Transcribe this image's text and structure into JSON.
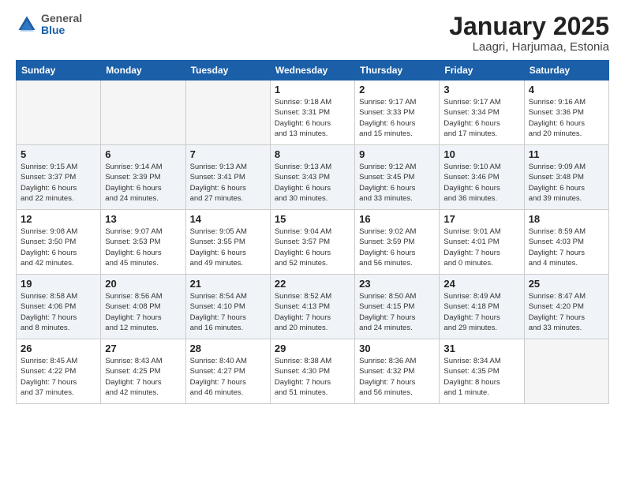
{
  "header": {
    "logo_general": "General",
    "logo_blue": "Blue",
    "title": "January 2025",
    "subtitle": "Laagri, Harjumaa, Estonia"
  },
  "weekdays": [
    "Sunday",
    "Monday",
    "Tuesday",
    "Wednesday",
    "Thursday",
    "Friday",
    "Saturday"
  ],
  "weeks": [
    [
      {
        "day": "",
        "info": ""
      },
      {
        "day": "",
        "info": ""
      },
      {
        "day": "",
        "info": ""
      },
      {
        "day": "1",
        "info": "Sunrise: 9:18 AM\nSunset: 3:31 PM\nDaylight: 6 hours\nand 13 minutes."
      },
      {
        "day": "2",
        "info": "Sunrise: 9:17 AM\nSunset: 3:33 PM\nDaylight: 6 hours\nand 15 minutes."
      },
      {
        "day": "3",
        "info": "Sunrise: 9:17 AM\nSunset: 3:34 PM\nDaylight: 6 hours\nand 17 minutes."
      },
      {
        "day": "4",
        "info": "Sunrise: 9:16 AM\nSunset: 3:36 PM\nDaylight: 6 hours\nand 20 minutes."
      }
    ],
    [
      {
        "day": "5",
        "info": "Sunrise: 9:15 AM\nSunset: 3:37 PM\nDaylight: 6 hours\nand 22 minutes."
      },
      {
        "day": "6",
        "info": "Sunrise: 9:14 AM\nSunset: 3:39 PM\nDaylight: 6 hours\nand 24 minutes."
      },
      {
        "day": "7",
        "info": "Sunrise: 9:13 AM\nSunset: 3:41 PM\nDaylight: 6 hours\nand 27 minutes."
      },
      {
        "day": "8",
        "info": "Sunrise: 9:13 AM\nSunset: 3:43 PM\nDaylight: 6 hours\nand 30 minutes."
      },
      {
        "day": "9",
        "info": "Sunrise: 9:12 AM\nSunset: 3:45 PM\nDaylight: 6 hours\nand 33 minutes."
      },
      {
        "day": "10",
        "info": "Sunrise: 9:10 AM\nSunset: 3:46 PM\nDaylight: 6 hours\nand 36 minutes."
      },
      {
        "day": "11",
        "info": "Sunrise: 9:09 AM\nSunset: 3:48 PM\nDaylight: 6 hours\nand 39 minutes."
      }
    ],
    [
      {
        "day": "12",
        "info": "Sunrise: 9:08 AM\nSunset: 3:50 PM\nDaylight: 6 hours\nand 42 minutes."
      },
      {
        "day": "13",
        "info": "Sunrise: 9:07 AM\nSunset: 3:53 PM\nDaylight: 6 hours\nand 45 minutes."
      },
      {
        "day": "14",
        "info": "Sunrise: 9:05 AM\nSunset: 3:55 PM\nDaylight: 6 hours\nand 49 minutes."
      },
      {
        "day": "15",
        "info": "Sunrise: 9:04 AM\nSunset: 3:57 PM\nDaylight: 6 hours\nand 52 minutes."
      },
      {
        "day": "16",
        "info": "Sunrise: 9:02 AM\nSunset: 3:59 PM\nDaylight: 6 hours\nand 56 minutes."
      },
      {
        "day": "17",
        "info": "Sunrise: 9:01 AM\nSunset: 4:01 PM\nDaylight: 7 hours\nand 0 minutes."
      },
      {
        "day": "18",
        "info": "Sunrise: 8:59 AM\nSunset: 4:03 PM\nDaylight: 7 hours\nand 4 minutes."
      }
    ],
    [
      {
        "day": "19",
        "info": "Sunrise: 8:58 AM\nSunset: 4:06 PM\nDaylight: 7 hours\nand 8 minutes."
      },
      {
        "day": "20",
        "info": "Sunrise: 8:56 AM\nSunset: 4:08 PM\nDaylight: 7 hours\nand 12 minutes."
      },
      {
        "day": "21",
        "info": "Sunrise: 8:54 AM\nSunset: 4:10 PM\nDaylight: 7 hours\nand 16 minutes."
      },
      {
        "day": "22",
        "info": "Sunrise: 8:52 AM\nSunset: 4:13 PM\nDaylight: 7 hours\nand 20 minutes."
      },
      {
        "day": "23",
        "info": "Sunrise: 8:50 AM\nSunset: 4:15 PM\nDaylight: 7 hours\nand 24 minutes."
      },
      {
        "day": "24",
        "info": "Sunrise: 8:49 AM\nSunset: 4:18 PM\nDaylight: 7 hours\nand 29 minutes."
      },
      {
        "day": "25",
        "info": "Sunrise: 8:47 AM\nSunset: 4:20 PM\nDaylight: 7 hours\nand 33 minutes."
      }
    ],
    [
      {
        "day": "26",
        "info": "Sunrise: 8:45 AM\nSunset: 4:22 PM\nDaylight: 7 hours\nand 37 minutes."
      },
      {
        "day": "27",
        "info": "Sunrise: 8:43 AM\nSunset: 4:25 PM\nDaylight: 7 hours\nand 42 minutes."
      },
      {
        "day": "28",
        "info": "Sunrise: 8:40 AM\nSunset: 4:27 PM\nDaylight: 7 hours\nand 46 minutes."
      },
      {
        "day": "29",
        "info": "Sunrise: 8:38 AM\nSunset: 4:30 PM\nDaylight: 7 hours\nand 51 minutes."
      },
      {
        "day": "30",
        "info": "Sunrise: 8:36 AM\nSunset: 4:32 PM\nDaylight: 7 hours\nand 56 minutes."
      },
      {
        "day": "31",
        "info": "Sunrise: 8:34 AM\nSunset: 4:35 PM\nDaylight: 8 hours\nand 1 minute."
      },
      {
        "day": "",
        "info": ""
      }
    ]
  ]
}
